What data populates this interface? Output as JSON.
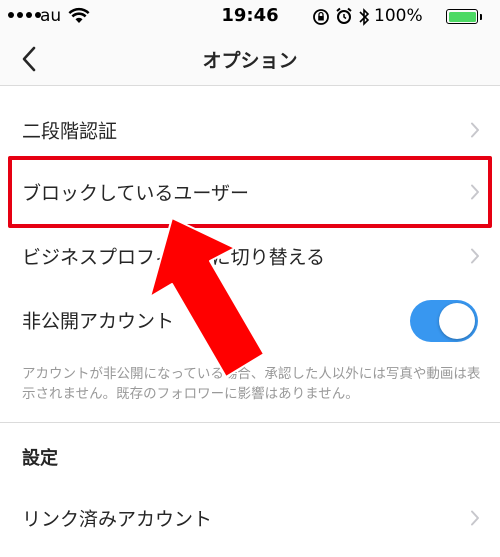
{
  "status_bar": {
    "carrier": "au",
    "time": "19:46",
    "battery_percent": "100%",
    "battery_level": 1.0,
    "battery_color": "#4cd964"
  },
  "navbar": {
    "back_icon": "chevron-left-icon",
    "title": "オプション"
  },
  "rows": {
    "two_factor": "二段階認証",
    "blocked_users": "ブロックしているユーザー",
    "business_profile": "ビジネスプロフィールに切り替える",
    "private_account": "非公開アカウント",
    "linked_accounts": "リンク済みアカウント"
  },
  "private_account": {
    "enabled": true,
    "toggle_color": "#3897f0",
    "description": "アカウントが非公開になっている場合、承認した人以外には写真や動画は表示されません。既存のフォロワーに影響はありません。"
  },
  "sections": {
    "settings_title": "設定"
  },
  "annotations": {
    "highlight_color": "#e60012",
    "arrow_color": "#ff0000"
  }
}
